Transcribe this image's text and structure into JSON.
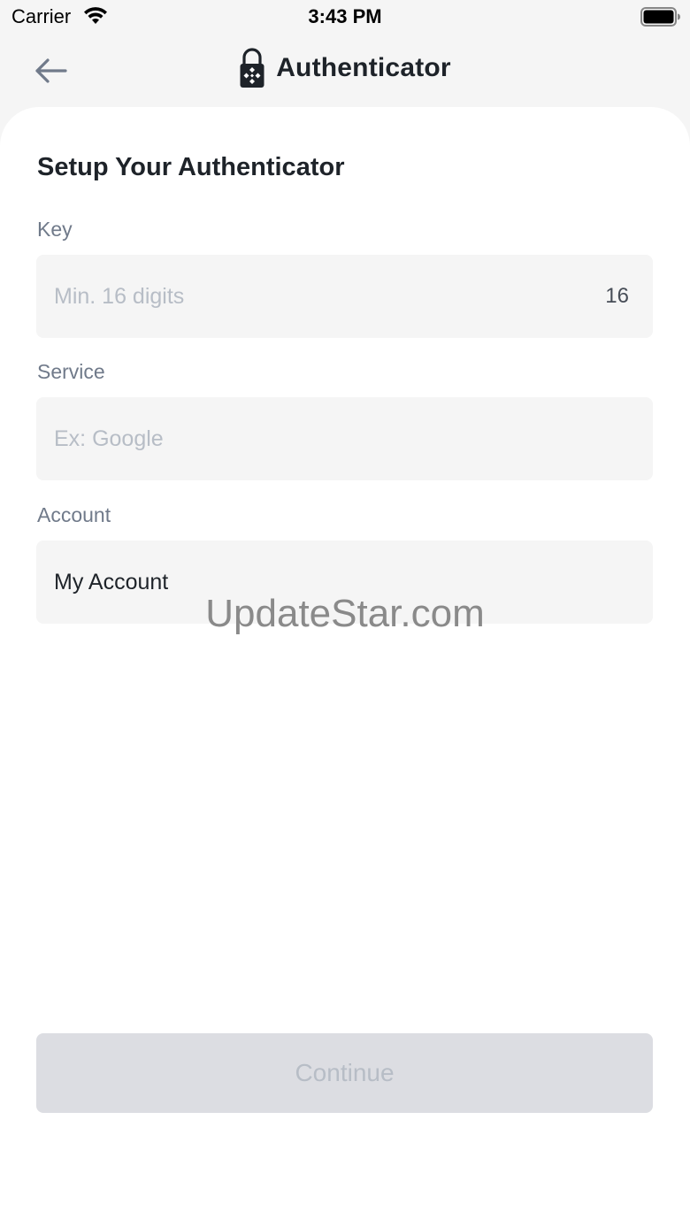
{
  "status_bar": {
    "carrier": "Carrier",
    "time": "3:43 PM"
  },
  "nav": {
    "back_icon": "arrow-left-icon",
    "title_icon": "padlock-icon",
    "title": "Authenticator"
  },
  "form": {
    "title": "Setup Your Authenticator",
    "key": {
      "label": "Key",
      "placeholder": "Min. 16 digits",
      "suffix": "16"
    },
    "service": {
      "label": "Service",
      "placeholder": "Ex: Google"
    },
    "account": {
      "label": "Account",
      "value": "My Account"
    },
    "continue_label": "Continue"
  },
  "watermark": "UpdateStar.com",
  "colors": {
    "background": "#f5f5f5",
    "card": "#ffffff",
    "field_background": "#f5f5f5",
    "label": "#707a8a",
    "placeholder": "#b7bdc6",
    "primary_text": "#1e2329",
    "button_disabled": "#dcdde2"
  }
}
